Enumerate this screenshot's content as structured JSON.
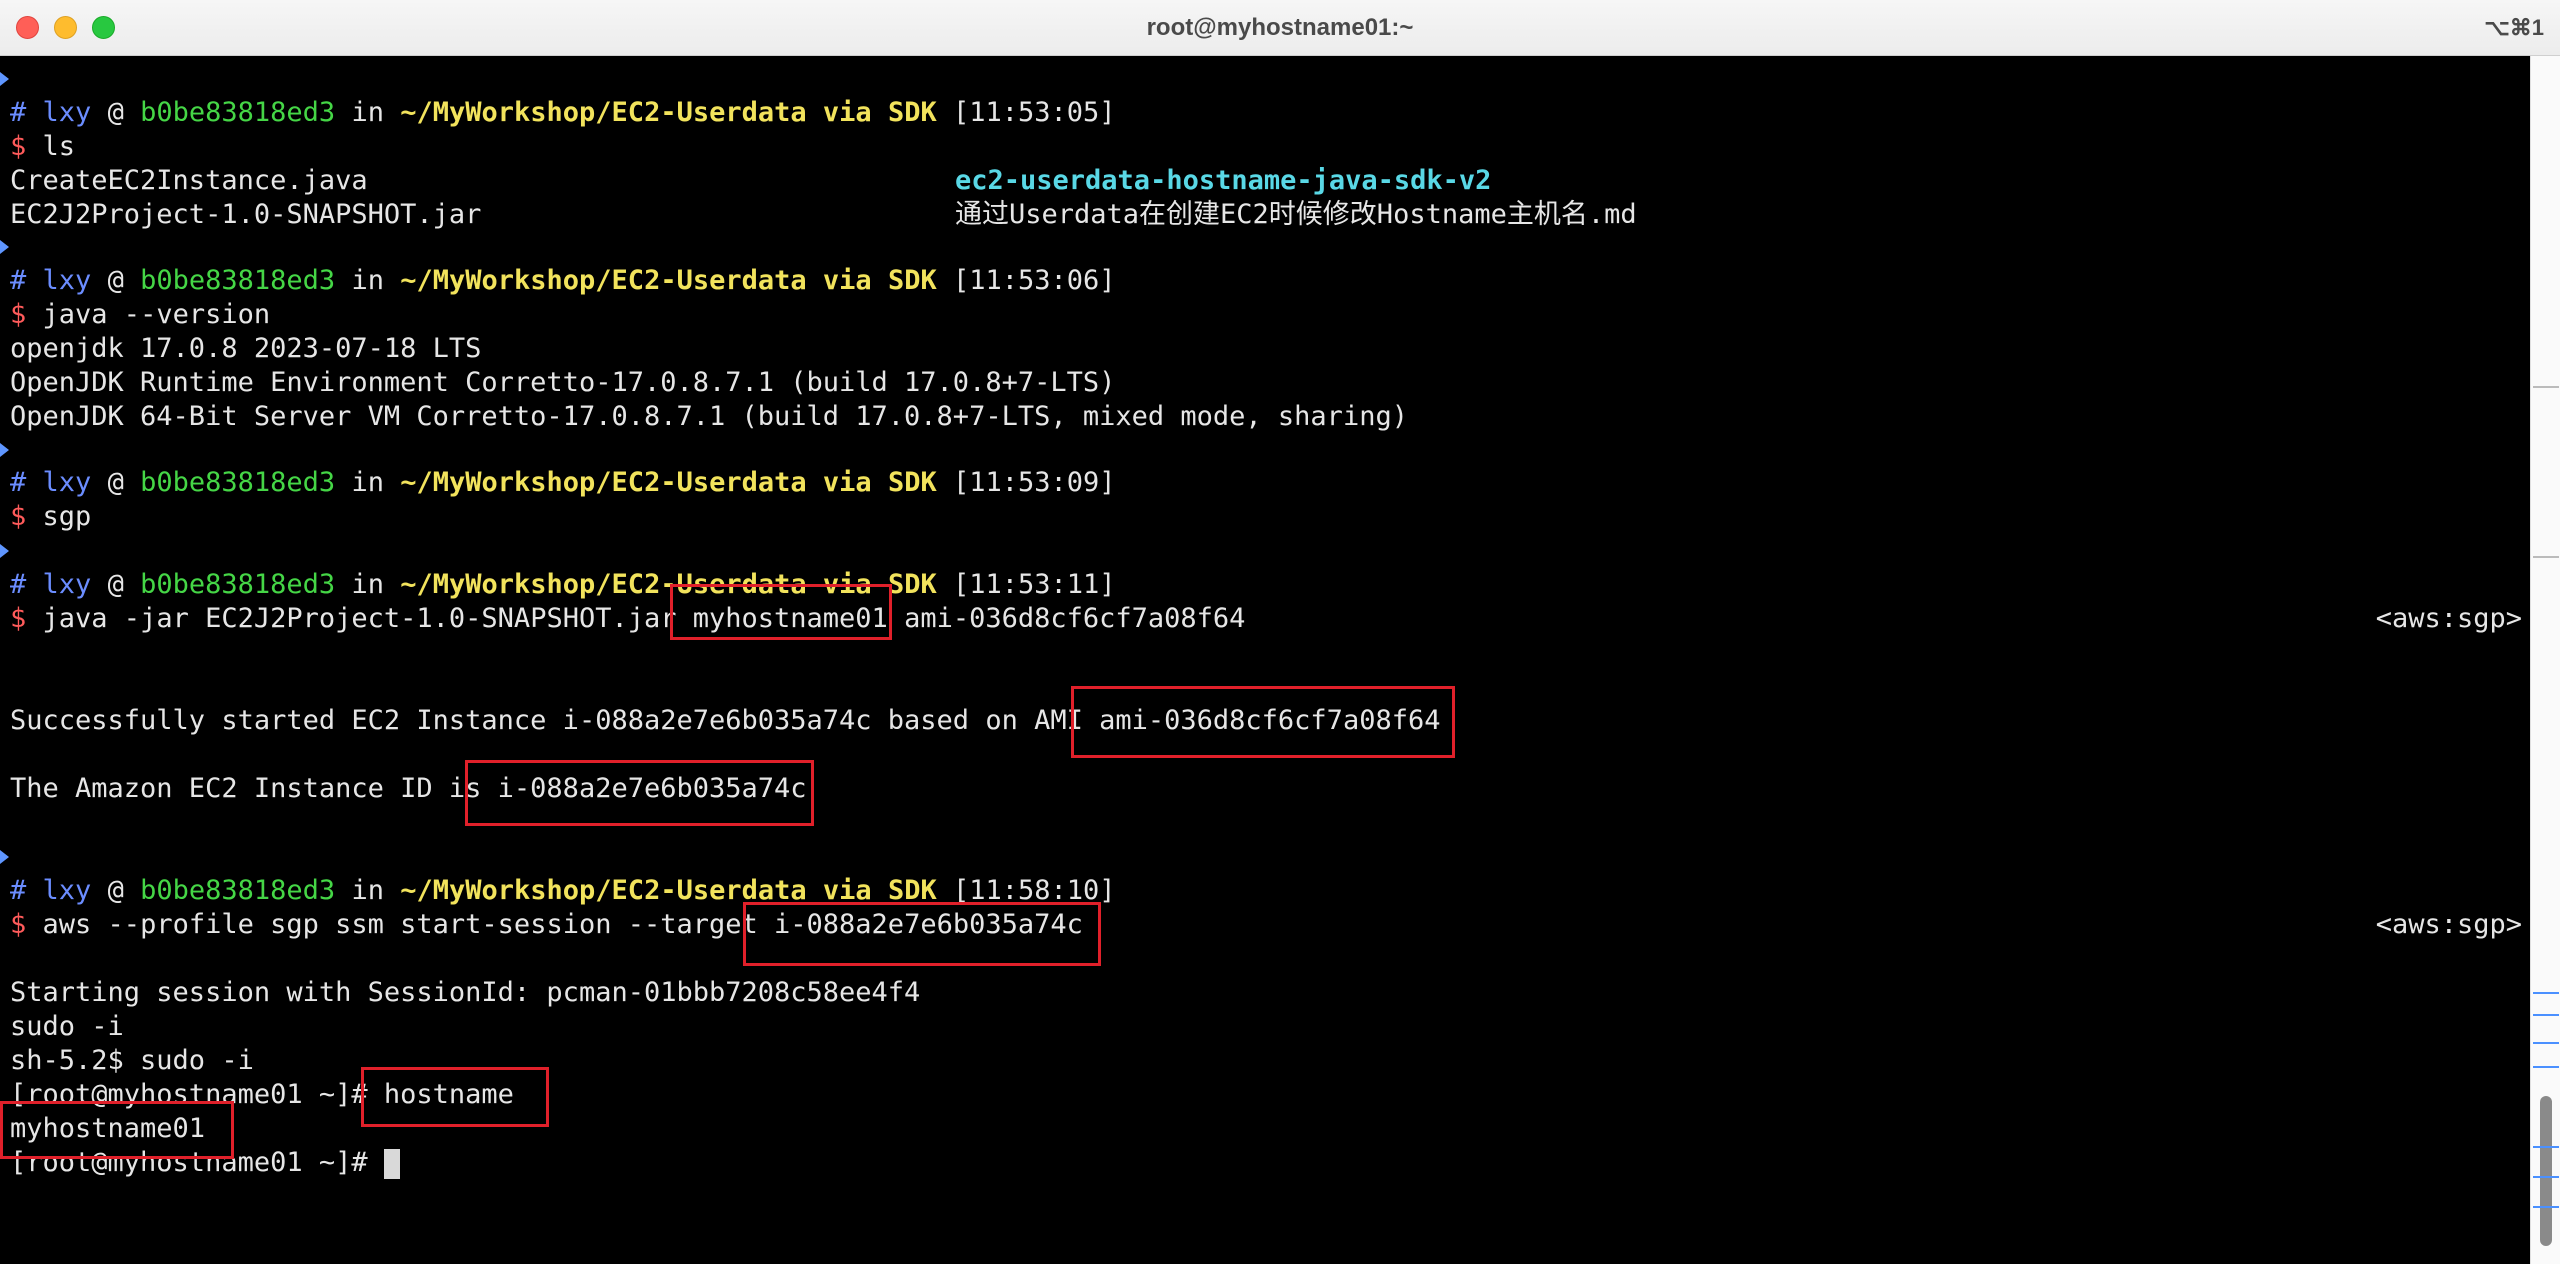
{
  "window": {
    "title": "root@myhostname01:~",
    "shortcut": "⌥⌘1"
  },
  "colors": {
    "prompt_user": "#6b8dff",
    "host": "#45d646",
    "path": "#f2e35c",
    "dollar": "#ff5b5b",
    "dir_entry": "#59d8e6",
    "highlight_box": "#e0202a"
  },
  "prompt": {
    "hash": "#",
    "user": "lxy",
    "at": "@",
    "host": "b0be83818ed3",
    "in": "in",
    "path": "~/MyWorkshop/EC2-Userdata",
    "via": "via",
    "sdk": "SDK",
    "dollar": "$"
  },
  "blocks": [
    {
      "time": "[11:53:05]",
      "command": "ls"
    },
    {
      "time": "[11:53:06]",
      "command": "java --version"
    },
    {
      "time": "[11:53:09]",
      "command": "sgp"
    },
    {
      "time": "[11:53:11]",
      "command": "java -jar EC2J2Project-1.0-SNAPSHOT.jar myhostname01 ami-036d8cf6cf7a08f64",
      "rprompt": "<aws:sgp>"
    },
    {
      "time": "[11:58:10]",
      "command": "aws --profile sgp ssm start-session --target i-088a2e7e6b035a74c",
      "rprompt": "<aws:sgp>"
    }
  ],
  "ls_output": {
    "col1": [
      "CreateEC2Instance.java",
      "EC2J2Project-1.0-SNAPSHOT.jar"
    ],
    "col2": [
      "ec2-userdata-hostname-java-sdk-v2",
      "通过Userdata在创建EC2时候修改Hostname主机名.md"
    ]
  },
  "java_version_output": [
    "openjdk 17.0.8 2023-07-18 LTS",
    "OpenJDK Runtime Environment Corretto-17.0.8.7.1 (build 17.0.8+7-LTS)",
    "OpenJDK 64-Bit Server VM Corretto-17.0.8.7.1 (build 17.0.8+7-LTS, mixed mode, sharing)"
  ],
  "ec2_output": [
    "Successfully started EC2 Instance i-088a2e7e6b035a74c based on AMI ami-036d8cf6cf7a08f64",
    "The Amazon EC2 Instance ID is i-088a2e7e6b035a74c"
  ],
  "ssm_output": [
    "Starting session with SessionId: pcman-01bbb7208c58ee4f4",
    "sudo -i",
    "sh-5.2$ sudo -i",
    "[root@myhostname01 ~]# hostname",
    "myhostname01",
    "[root@myhostname01 ~]# "
  ]
}
